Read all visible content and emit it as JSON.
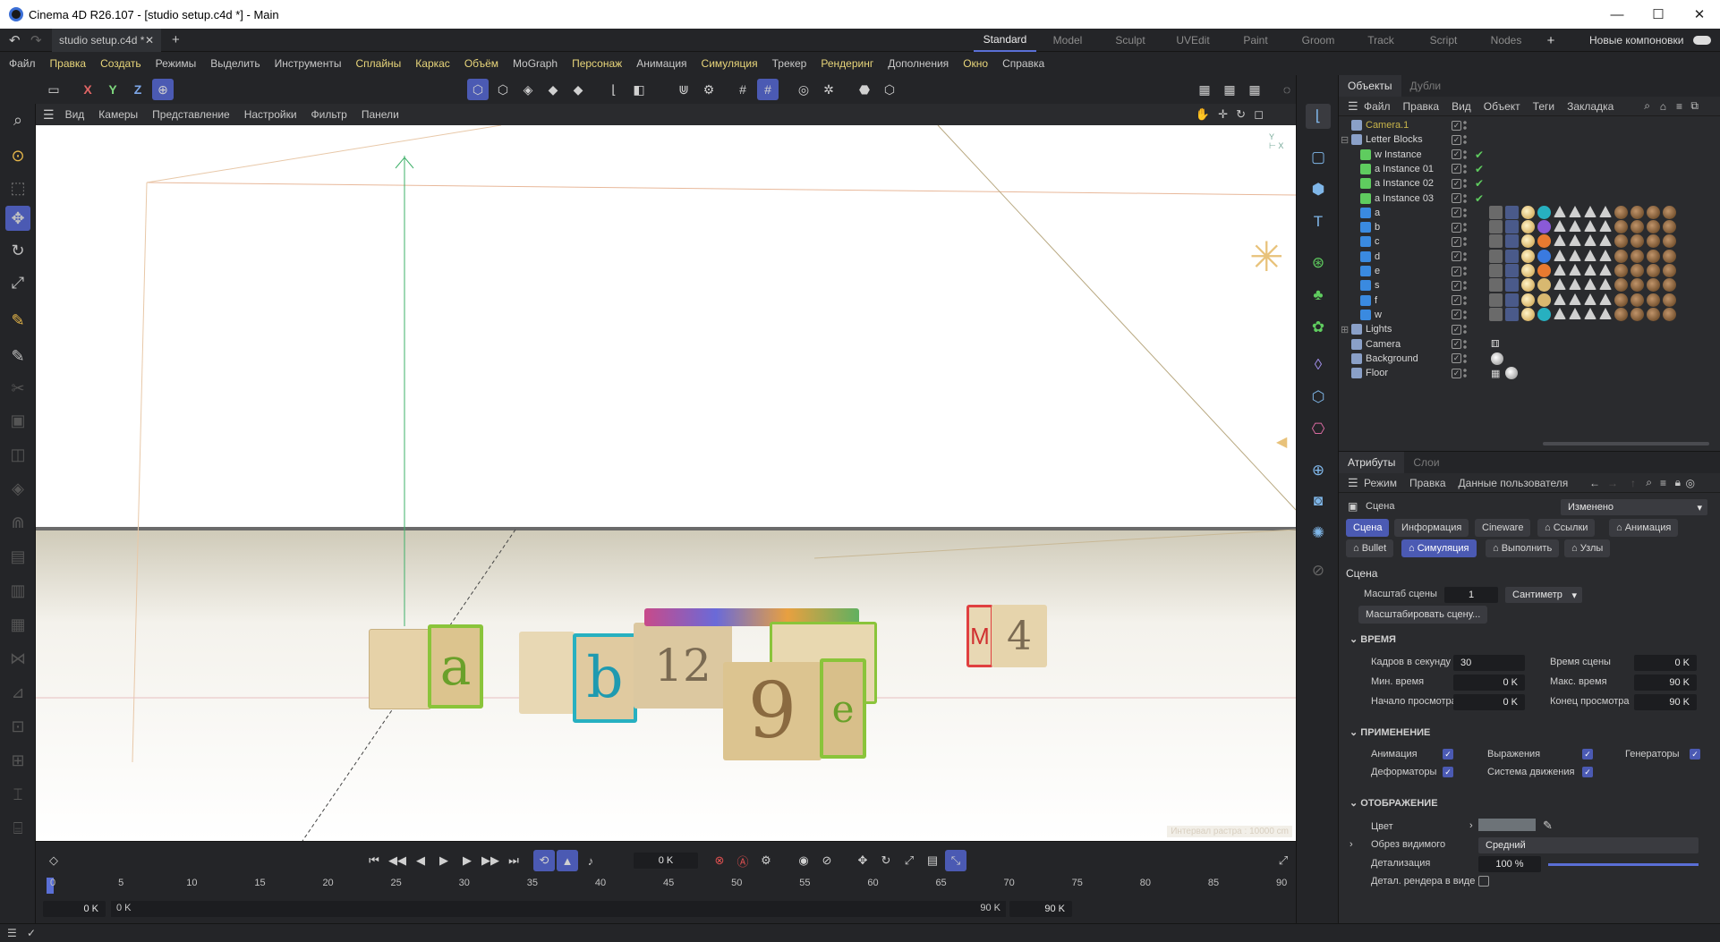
{
  "window": {
    "title": "Cinema 4D R26.107 - [studio setup.c4d *] - Main",
    "min": "—",
    "max": "☐",
    "close": "✕"
  },
  "tabs": {
    "doc": "studio setup.c4d *",
    "layouts": [
      "Standard",
      "Model",
      "Sculpt",
      "UVEdit",
      "Paint",
      "Groom",
      "Track",
      "Script",
      "Nodes"
    ],
    "new_layouts": "Новые компоновки"
  },
  "menu": [
    "Файл",
    "Правка",
    "Создать",
    "Режимы",
    "Выделить",
    "Инструменты",
    "Сплайны",
    "Каркас",
    "Объём",
    "MoGraph",
    "Персонаж",
    "Анимация",
    "Симуляция",
    "Трекер",
    "Рендеринг",
    "Дополнения",
    "Окно",
    "Справка"
  ],
  "toolbar": {
    "axes": [
      "X",
      "Y",
      "Z"
    ]
  },
  "viewport": {
    "menu": [
      "Вид",
      "Камеры",
      "Представление",
      "Настройки",
      "Фильтр",
      "Панели"
    ],
    "grid_info": "Интервал растра : 10000 cm"
  },
  "objects": {
    "tabs": [
      "Объекты",
      "Дубли"
    ],
    "menu": [
      "Файл",
      "Правка",
      "Вид",
      "Объект",
      "Теги",
      "Закладка"
    ],
    "rows": [
      {
        "name": "Camera.1",
        "indent": 0,
        "color": "#c8b44a",
        "highlight": true
      },
      {
        "name": "Letter Blocks",
        "indent": 0,
        "expand": "⊟"
      },
      {
        "name": "w Instance",
        "indent": 1,
        "green": true
      },
      {
        "name": "a Instance 01",
        "indent": 1,
        "green": true
      },
      {
        "name": "a Instance 02",
        "indent": 1,
        "green": true
      },
      {
        "name": "a Instance 03",
        "indent": 1,
        "green": true
      },
      {
        "name": "a",
        "indent": 1,
        "tags": true
      },
      {
        "name": "b",
        "indent": 1,
        "tags": true
      },
      {
        "name": "c",
        "indent": 1,
        "tags": true
      },
      {
        "name": "d",
        "indent": 1,
        "tags": true
      },
      {
        "name": "e",
        "indent": 1,
        "tags": true
      },
      {
        "name": "s",
        "indent": 1,
        "tags": true
      },
      {
        "name": "f",
        "indent": 1,
        "tags": true
      },
      {
        "name": "w",
        "indent": 1,
        "tags": true
      },
      {
        "name": "Lights",
        "indent": 0,
        "expand": "⊞"
      },
      {
        "name": "Camera",
        "indent": 0
      },
      {
        "name": "Background",
        "indent": 0
      },
      {
        "name": "Floor",
        "indent": 0
      }
    ]
  },
  "attributes": {
    "tabs": [
      "Атрибуты",
      "Слои"
    ],
    "menu": [
      "Режим",
      "Правка",
      "Данные пользователя"
    ],
    "scene_label": "Сцена",
    "changed": "Изменено",
    "buttons_row1": [
      "Сцена",
      "Информация",
      "Cineware",
      "Ссылки",
      "Анимация"
    ],
    "buttons_row2": [
      "Bullet",
      "Симуляция",
      "Выполнить",
      "Узлы"
    ],
    "section_title": "Сцена",
    "scale_label": "Масштаб сцены",
    "scale_value": "1",
    "unit": "Сантиметр",
    "scale_btn": "Масштабировать сцену...",
    "time_section": "ВРЕМЯ",
    "fps_label": "Кадров в секунду",
    "fps": "30",
    "scene_time_label": "Время сцены",
    "scene_time": "0 K",
    "min_time_label": "Мин. время",
    "min_time": "0 K",
    "max_time_label": "Макс. время",
    "max_time": "90 K",
    "preview_start_label": "Начало просмотра",
    "preview_start": "0 K",
    "preview_end_label": "Конец просмотра",
    "preview_end": "90 K",
    "apply_section": "ПРИМЕНЕНИЕ",
    "anim_label": "Анимация",
    "expr_label": "Выражения",
    "gen_label": "Генераторы",
    "deform_label": "Деформаторы",
    "motion_label": "Система движения",
    "display_section": "ОТОБРАЖЕНИЕ",
    "color_label": "Цвет",
    "clip_label": "Обрез видимого",
    "clip_value": "Средний",
    "detail_label": "Детализация",
    "detail_value": "100 %",
    "render_detail_label": "Детал. рендера в виде"
  },
  "timeline": {
    "frame": "0 K",
    "ticks": [
      "0",
      "5",
      "10",
      "15",
      "20",
      "25",
      "30",
      "35",
      "40",
      "45",
      "50",
      "55",
      "60",
      "65",
      "70",
      "75",
      "80",
      "85",
      "90"
    ],
    "start_a": "0 K",
    "start_b": "0 K",
    "end_a": "90 K",
    "end_b": "90 K"
  }
}
